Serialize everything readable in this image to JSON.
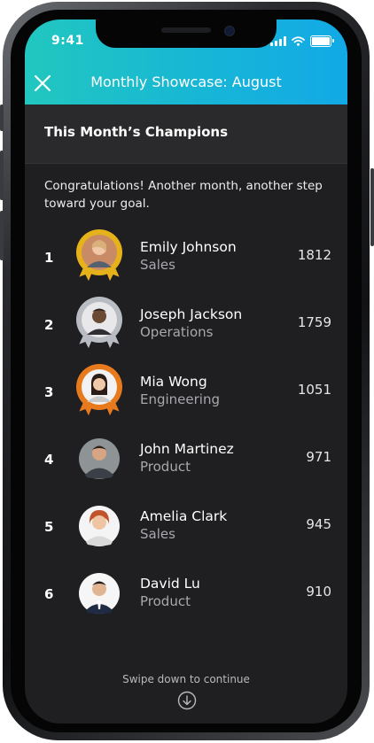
{
  "status_bar": {
    "time": "9:41",
    "icons": [
      "signal-icon",
      "wifi-icon",
      "battery-icon"
    ]
  },
  "header": {
    "title": "Monthly Showcase: August",
    "close_icon": "close-icon"
  },
  "section": {
    "title": "This Month’s Champions"
  },
  "intro": "Congratulations! Another month, another step toward your goal.",
  "leaderboard": [
    {
      "rank": "1",
      "name": "Emily Johnson",
      "department": "Sales",
      "score": "1812",
      "badge": "gold"
    },
    {
      "rank": "2",
      "name": "Joseph Jackson",
      "department": "Operations",
      "score": "1759",
      "badge": "silver"
    },
    {
      "rank": "3",
      "name": "Mia Wong",
      "department": "Engineering",
      "score": "1051",
      "badge": "bronze"
    },
    {
      "rank": "4",
      "name": "John Martinez",
      "department": "Product",
      "score": "971",
      "badge": "none"
    },
    {
      "rank": "5",
      "name": "Amelia Clark",
      "department": "Sales",
      "score": "945",
      "badge": "none"
    },
    {
      "rank": "6",
      "name": "David Lu",
      "department": "Product",
      "score": "910",
      "badge": "none"
    }
  ],
  "footer": {
    "hint": "Swipe down to continue",
    "icon": "arrow-down-circle-icon"
  },
  "colors": {
    "header_gradient_start": "#21c7bf",
    "header_gradient_end": "#12a9e6",
    "background": "#1f1f21",
    "gold": "#e6b21b",
    "silver": "#b9bcc2",
    "bronze": "#e87a1e"
  }
}
